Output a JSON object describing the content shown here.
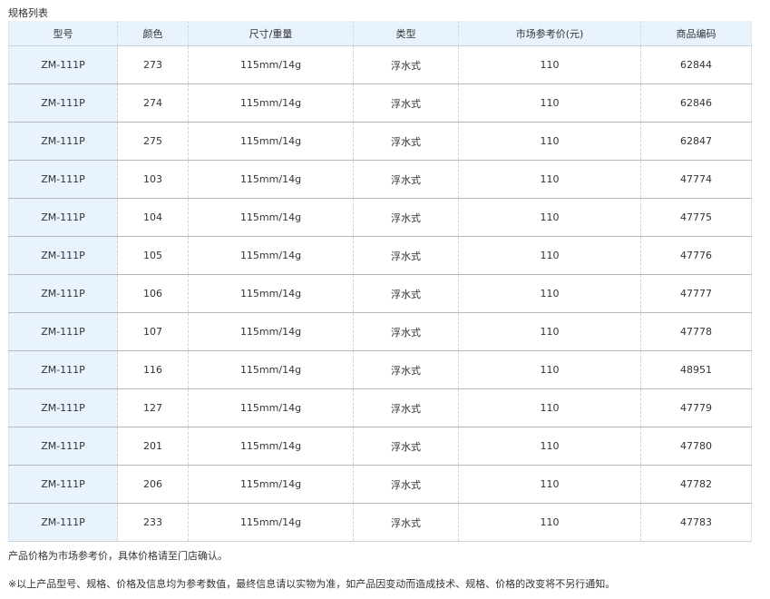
{
  "table_caption": "规格列表",
  "table": {
    "headers": [
      "型号",
      "颜色",
      "尺寸/重量",
      "类型",
      "市场参考价(元)",
      "商品编码"
    ],
    "rows": [
      [
        "ZM-111P",
        "273",
        "115mm/14g",
        "浮水式",
        "110",
        "62844"
      ],
      [
        "ZM-111P",
        "274",
        "115mm/14g",
        "浮水式",
        "110",
        "62846"
      ],
      [
        "ZM-111P",
        "275",
        "115mm/14g",
        "浮水式",
        "110",
        "62847"
      ],
      [
        "ZM-111P",
        "103",
        "115mm/14g",
        "浮水式",
        "110",
        "47774"
      ],
      [
        "ZM-111P",
        "104",
        "115mm/14g",
        "浮水式",
        "110",
        "47775"
      ],
      [
        "ZM-111P",
        "105",
        "115mm/14g",
        "浮水式",
        "110",
        "47776"
      ],
      [
        "ZM-111P",
        "106",
        "115mm/14g",
        "浮水式",
        "110",
        "47777"
      ],
      [
        "ZM-111P",
        "107",
        "115mm/14g",
        "浮水式",
        "110",
        "47778"
      ],
      [
        "ZM-111P",
        "116",
        "115mm/14g",
        "浮水式",
        "110",
        "48951"
      ],
      [
        "ZM-111P",
        "127",
        "115mm/14g",
        "浮水式",
        "110",
        "47779"
      ],
      [
        "ZM-111P",
        "201",
        "115mm/14g",
        "浮水式",
        "110",
        "47780"
      ],
      [
        "ZM-111P",
        "206",
        "115mm/14g",
        "浮水式",
        "110",
        "47782"
      ],
      [
        "ZM-111P",
        "233",
        "115mm/14g",
        "浮水式",
        "110",
        "47783"
      ]
    ]
  },
  "notes": {
    "price_note": "产品价格为市场参考价，具体价格请至门店确认。",
    "disclaimer": "※以上产品型号、规格、价格及信息均为参考数值，最终信息请以实物为准，如产品因变动而造成技术、规格、价格的改变将不另行通知。"
  },
  "colors": {
    "header_background": "#e8f3fd",
    "first_column_background": "#e8f3fd",
    "row_divider": "#b8b8b8",
    "text": "#333333"
  }
}
